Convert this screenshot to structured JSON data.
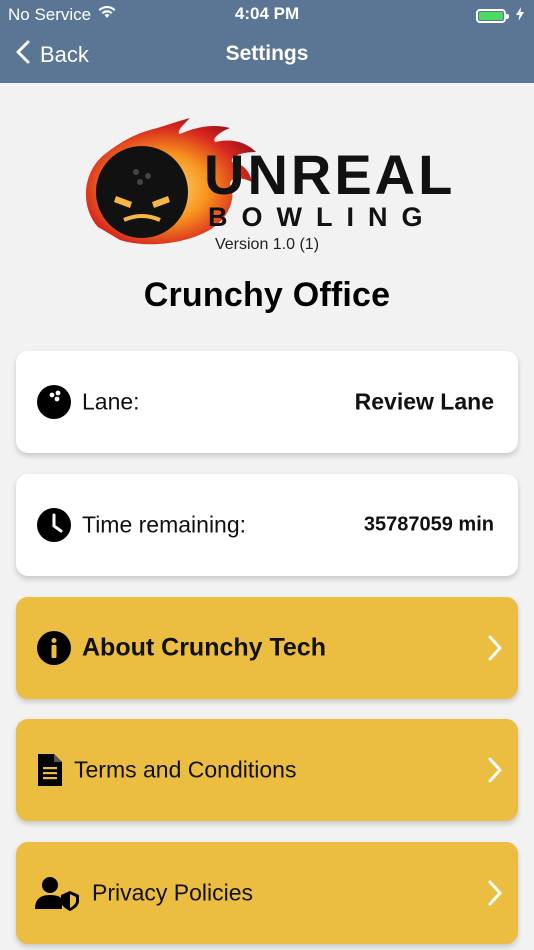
{
  "status_bar": {
    "carrier": "No Service",
    "time": "4:04 PM"
  },
  "nav": {
    "back_label": "Back",
    "title": "Settings"
  },
  "logo": {
    "brand_line1": "UNREAL",
    "brand_line2": "BOWLING"
  },
  "version": "Version 1.0 (1)",
  "office_name": "Crunchy Office",
  "info": {
    "lane_label": "Lane:",
    "lane_value": "Review Lane",
    "time_label": "Time remaining:",
    "time_value": "35787059 min"
  },
  "menu": [
    {
      "label": "About Crunchy Tech",
      "icon": "info-icon"
    },
    {
      "label": "Terms and Conditions",
      "icon": "document-icon"
    },
    {
      "label": "Privacy Policies",
      "icon": "user-shield-icon"
    }
  ],
  "colors": {
    "header": "#5b7595",
    "accent": "#ebbd40",
    "battery": "#4cd964"
  }
}
